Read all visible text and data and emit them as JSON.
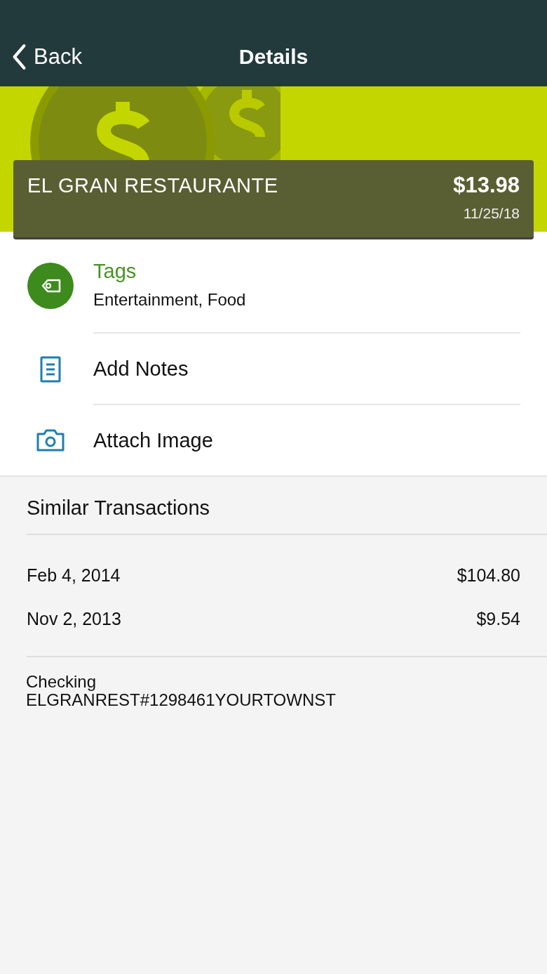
{
  "nav": {
    "back": "Back",
    "title": "Details"
  },
  "transaction": {
    "merchant": "EL GRAN RESTAURANTE",
    "amount": "$13.98",
    "date": "11/25/18"
  },
  "actions": [
    {
      "kind": "tags",
      "label": "Tags",
      "detail": "Entertainment, Food"
    },
    {
      "kind": "notes",
      "label": "Add Notes"
    },
    {
      "kind": "image",
      "label": "Attach Image"
    }
  ],
  "similar": {
    "title": "Similar Transactions",
    "rows": [
      {
        "date": "Feb 4, 2014",
        "amount": "$104.80"
      },
      {
        "date": "Nov 2, 2013",
        "amount": "$9.54"
      }
    ]
  },
  "account": {
    "type": "Checking",
    "description": "ELGRANREST#1298461YOURTOWNST"
  }
}
